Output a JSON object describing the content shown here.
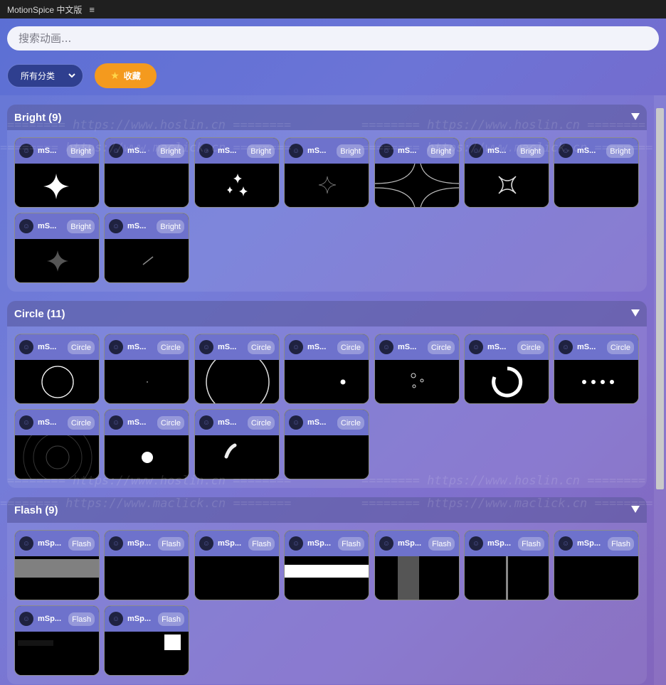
{
  "titlebar": {
    "title": "MotionSpice 中文版",
    "menu_icon": "≡"
  },
  "search": {
    "placeholder": "搜索动画..."
  },
  "filter": {
    "category_label": "所有分类",
    "favorites_label": "收藏"
  },
  "watermarks": {
    "hoslin": "======== https://www.hoslin.cn ========",
    "maclick": "======== https://www.maclick.cn ========"
  },
  "sections": [
    {
      "title": "Bright",
      "count": "(9)",
      "cards": [
        {
          "name": "mS...",
          "tag": "Bright",
          "preview": "big-sparkle"
        },
        {
          "name": "mS...",
          "tag": "Bright",
          "preview": "blank"
        },
        {
          "name": "mS...",
          "tag": "Bright",
          "preview": "twin-sparkle"
        },
        {
          "name": "mS...",
          "tag": "Bright",
          "preview": "faint-sparkle"
        },
        {
          "name": "mS...",
          "tag": "Bright",
          "preview": "curved-star"
        },
        {
          "name": "mS...",
          "tag": "Bright",
          "preview": "outline-star"
        },
        {
          "name": "mS...",
          "tag": "Bright",
          "preview": "blank"
        },
        {
          "name": "mS...",
          "tag": "Bright",
          "preview": "dim-star"
        },
        {
          "name": "mS...",
          "tag": "Bright",
          "preview": "streak"
        }
      ]
    },
    {
      "title": "Circle",
      "count": "(11)",
      "cards": [
        {
          "name": "mS...",
          "tag": "Circle",
          "preview": "ring"
        },
        {
          "name": "mS...",
          "tag": "Circle",
          "preview": "tiny-dot"
        },
        {
          "name": "mS...",
          "tag": "Circle",
          "preview": "big-ring"
        },
        {
          "name": "mS...",
          "tag": "Circle",
          "preview": "dot"
        },
        {
          "name": "mS...",
          "tag": "Circle",
          "preview": "bubbles"
        },
        {
          "name": "mS...",
          "tag": "Circle",
          "preview": "spinner"
        },
        {
          "name": "mS...",
          "tag": "Circle",
          "preview": "four-dots"
        },
        {
          "name": "mS...",
          "tag": "Circle",
          "preview": "concentric"
        },
        {
          "name": "mS...",
          "tag": "Circle",
          "preview": "white-dot"
        },
        {
          "name": "mS...",
          "tag": "Circle",
          "preview": "arc-glow"
        },
        {
          "name": "mS...",
          "tag": "Circle",
          "preview": "blank"
        }
      ]
    },
    {
      "title": "Flash",
      "count": "(9)",
      "cards": [
        {
          "name": "mSp...",
          "tag": "Flash",
          "preview": "gray-band"
        },
        {
          "name": "mSp...",
          "tag": "Flash",
          "preview": "blank"
        },
        {
          "name": "mSp...",
          "tag": "Flash",
          "preview": "blank"
        },
        {
          "name": "mSp...",
          "tag": "Flash",
          "preview": "white-band"
        },
        {
          "name": "mSp...",
          "tag": "Flash",
          "preview": "gray-column"
        },
        {
          "name": "mSp...",
          "tag": "Flash",
          "preview": "thin-line"
        },
        {
          "name": "mSp...",
          "tag": "Flash",
          "preview": "blank"
        },
        {
          "name": "mSp...",
          "tag": "Flash",
          "preview": "dark-bar"
        },
        {
          "name": "mSp...",
          "tag": "Flash",
          "preview": "white-square"
        }
      ]
    }
  ]
}
